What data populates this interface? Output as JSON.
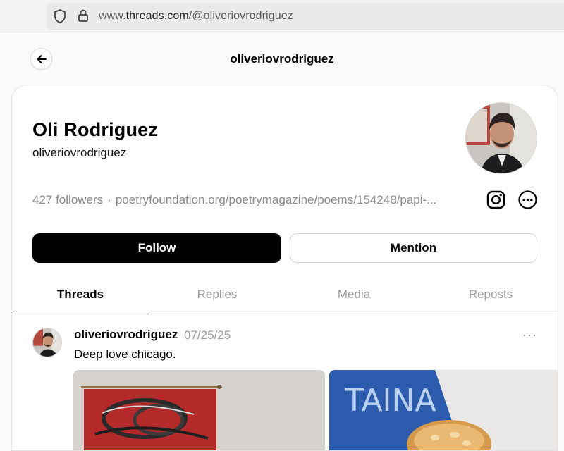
{
  "browser": {
    "url_prefix": "www.",
    "url_domain": "threads.com",
    "url_path": "/@oliveriovrodriguez"
  },
  "header": {
    "title": "oliveriovrodriguez"
  },
  "profile": {
    "name": "Oli Rodriguez",
    "handle": "oliveriovrodriguez",
    "followers": "427 followers",
    "separator": "·",
    "link": "poetryfoundation.org/poetrymagazine/poems/154248/papi-...",
    "follow_label": "Follow",
    "mention_label": "Mention"
  },
  "tabs": [
    {
      "label": "Threads"
    },
    {
      "label": "Replies"
    },
    {
      "label": "Media"
    },
    {
      "label": "Reposts"
    }
  ],
  "post": {
    "username": "oliveriovrodriguez",
    "date": "07/25/25",
    "more": "···",
    "text": "Deep love chicago."
  },
  "colors": {
    "accent": "#000000",
    "muted_text": "#9a9a9a",
    "image_blue": "#2d5cae"
  },
  "icons": [
    "shield-icon",
    "lock-icon",
    "back-arrow-icon",
    "instagram-icon",
    "more-options-icon"
  ]
}
